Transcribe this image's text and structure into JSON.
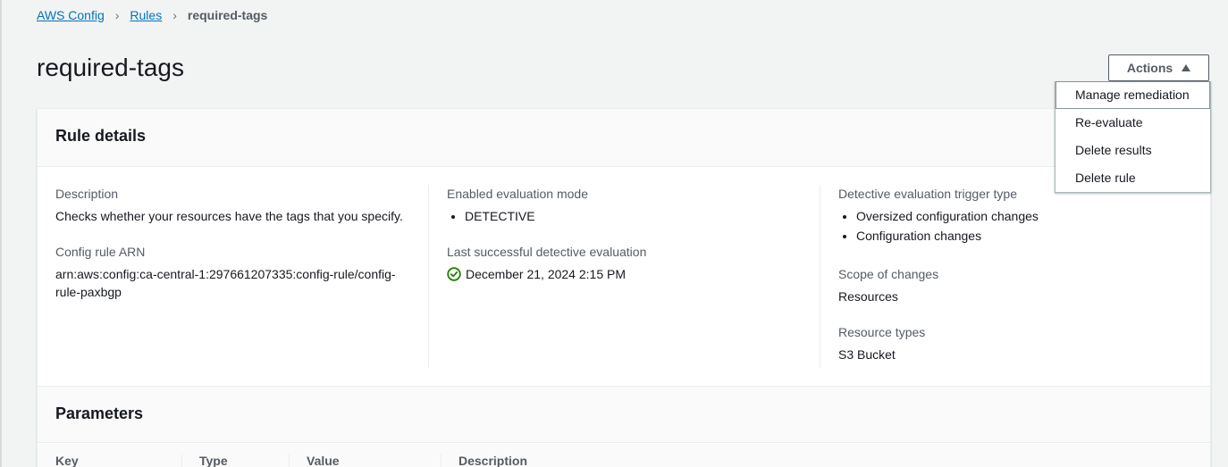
{
  "breadcrumb": {
    "items": [
      "AWS Config",
      "Rules"
    ],
    "current": "required-tags"
  },
  "page_title": "required-tags",
  "actions": {
    "label": "Actions",
    "menu": [
      "Manage remediation",
      "Re-evaluate",
      "Delete results",
      "Delete rule"
    ]
  },
  "rule_details": {
    "title": "Rule details",
    "description_label": "Description",
    "description": "Checks whether your resources have the tags that you specify.",
    "arn_label": "Config rule ARN",
    "arn_line1": "arn:aws:config:ca-central-1:297661207335:config-rule/config-",
    "arn_line2": "rule-paxbgp",
    "eval_mode_label": "Enabled evaluation mode",
    "eval_mode": "DETECTIVE",
    "last_eval_label": "Last successful detective evaluation",
    "last_eval": "December 21, 2024 2:15 PM",
    "trigger_label": "Detective evaluation trigger type",
    "triggers": [
      "Oversized configuration changes",
      "Configuration changes"
    ],
    "scope_label": "Scope of changes",
    "scope": "Resources",
    "resource_types_label": "Resource types",
    "resource_types": "S3 Bucket"
  },
  "parameters": {
    "title": "Parameters",
    "columns": [
      "Key",
      "Type",
      "Value",
      "Description"
    ]
  },
  "colors": {
    "link": "#0073bb",
    "success": "#1d8102"
  }
}
